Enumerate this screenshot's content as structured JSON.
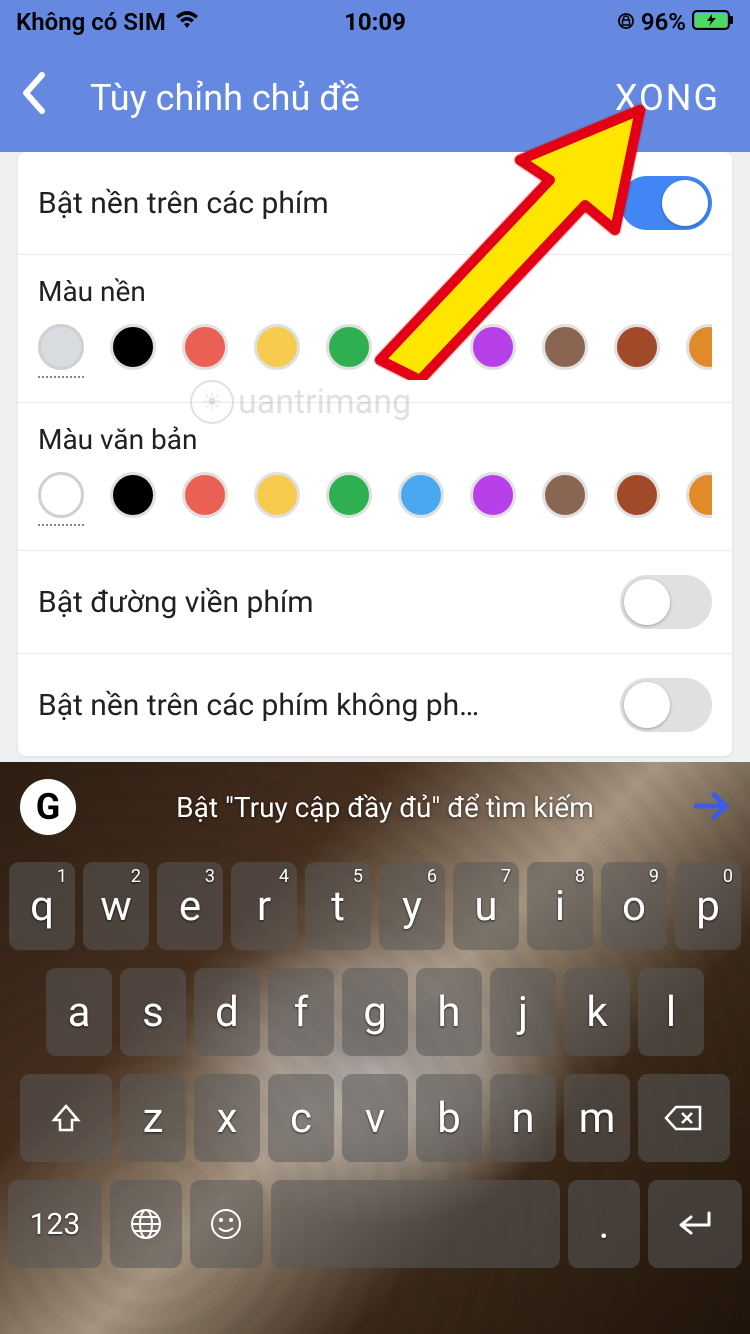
{
  "status": {
    "carrier": "Không có SIM",
    "time": "10:09",
    "battery": "96%"
  },
  "header": {
    "title": "Tùy chỉnh chủ đề",
    "done": "XONG"
  },
  "settings": {
    "key_bg_label": "Bật nền trên các phím",
    "key_bg_on": true,
    "bg_color_label": "Màu nền",
    "text_color_label": "Màu văn bản",
    "key_border_label": "Bật đường viền phím",
    "key_border_on": false,
    "extra_keys_label": "Bật nền trên các phím không ph…",
    "extra_keys_on": false,
    "colors_bg": [
      "#d8dce0",
      "#000000",
      "#ea6054",
      "#f7cb4d",
      "#2eb050",
      "#4aa8f0",
      "#b840e8",
      "#8a6652",
      "#a04a2a",
      "#e08a2a"
    ],
    "colors_text": [
      "#ffffff",
      "#000000",
      "#ea6054",
      "#f7cb4d",
      "#2eb050",
      "#4aa8f0",
      "#b840e8",
      "#8a6652",
      "#a04a2a",
      "#e08a2a"
    ]
  },
  "watermark": "uantrimang",
  "keyboard": {
    "hint": "Bật \"Truy cập đầy đủ\" để tìm kiếm",
    "g": "G",
    "row1": [
      {
        "k": "q",
        "n": "1"
      },
      {
        "k": "w",
        "n": "2"
      },
      {
        "k": "e",
        "n": "3"
      },
      {
        "k": "r",
        "n": "4"
      },
      {
        "k": "t",
        "n": "5"
      },
      {
        "k": "y",
        "n": "6"
      },
      {
        "k": "u",
        "n": "7"
      },
      {
        "k": "i",
        "n": "8"
      },
      {
        "k": "o",
        "n": "9"
      },
      {
        "k": "p",
        "n": "0"
      }
    ],
    "row2": [
      "a",
      "s",
      "d",
      "f",
      "g",
      "h",
      "j",
      "k",
      "l"
    ],
    "row3": [
      "z",
      "x",
      "c",
      "v",
      "b",
      "n",
      "m"
    ],
    "numeric": "123",
    "dot": "."
  }
}
